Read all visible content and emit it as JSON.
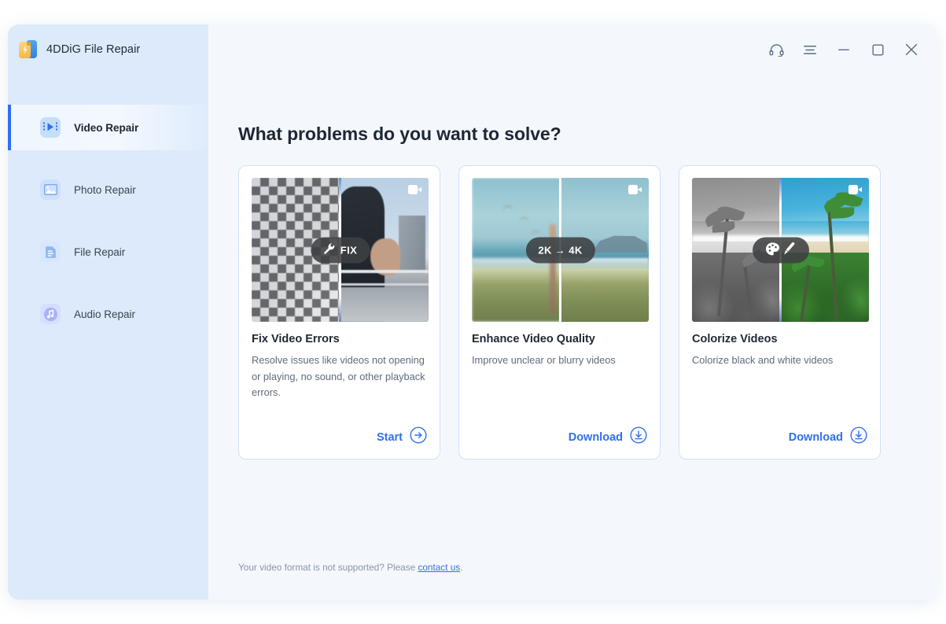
{
  "app": {
    "title": "4DDiG File Repair",
    "icon": "app-logo-icon"
  },
  "titlebar": {
    "buttons": [
      {
        "name": "support-headset-icon",
        "label": "Support"
      },
      {
        "name": "menu-icon",
        "label": "Menu"
      },
      {
        "name": "minimize-icon",
        "label": "Minimize"
      },
      {
        "name": "maximize-icon",
        "label": "Maximize"
      },
      {
        "name": "close-icon",
        "label": "Close"
      }
    ]
  },
  "sidebar": {
    "items": [
      {
        "label": "Video Repair",
        "icon": "video-repair-icon",
        "active": true
      },
      {
        "label": "Photo Repair",
        "icon": "photo-repair-icon",
        "active": false
      },
      {
        "label": "File Repair",
        "icon": "file-repair-icon",
        "active": false
      },
      {
        "label": "Audio Repair",
        "icon": "audio-repair-icon",
        "active": false
      }
    ]
  },
  "main": {
    "heading": "What problems do you want to solve?",
    "cards": [
      {
        "title": "Fix Video Errors",
        "description": "Resolve issues like videos not opening or playing, no sound, or other playback errors.",
        "badge_text": "FIX",
        "badge_icon": "wrench-icon",
        "corner_icon": "video-camera-icon",
        "action_label": "Start",
        "action_icon": "arrow-right-circle-icon"
      },
      {
        "title": "Enhance Video Quality",
        "description": "Improve unclear or blurry videos",
        "badge_text": "2K → 4K",
        "badge_icon": "",
        "corner_icon": "video-camera-icon",
        "action_label": "Download",
        "action_icon": "download-circle-icon"
      },
      {
        "title": "Colorize Videos",
        "description": "Colorize black and white videos",
        "badge_text": "",
        "badge_icon": "palette-brush-icon",
        "corner_icon": "video-camera-icon",
        "action_label": "Download",
        "action_icon": "download-circle-icon"
      }
    ],
    "footer": {
      "text_before": "Your video format is not supported? Please ",
      "link_text": "contact us",
      "text_after": "."
    }
  },
  "colors": {
    "accent": "#2f6ff0",
    "sidebar_bg": "#dceafb",
    "content_bg": "#f4f8fd",
    "card_border": "#cfe0f7",
    "title_text": "#1e2733",
    "muted_text": "#5f6b79"
  }
}
